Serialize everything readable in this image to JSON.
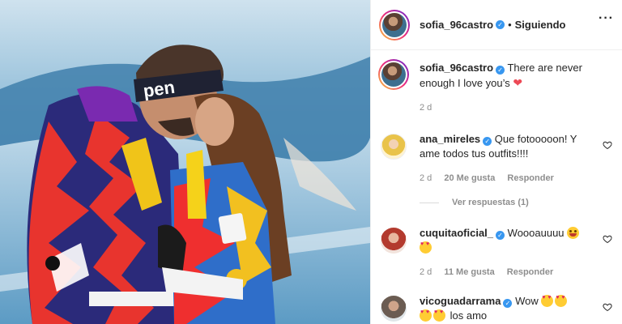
{
  "post": {
    "author": "sofia_96castro",
    "follow_status": "Siguiendo",
    "caption": "There are never enough I love you’s",
    "caption_time": "2 d",
    "photo_hat_text": "pen"
  },
  "comments": [
    {
      "user": "ana_mireles",
      "verified": true,
      "text": "Que fotooooon! Y ame todos tus outfits!!!!",
      "time": "2 d",
      "likes": "20 Me gusta",
      "reply": "Responder",
      "view_replies": "Ver respuestas (1)"
    },
    {
      "user": "cuquitaoficial_",
      "verified": true,
      "text": "Woooauuuu",
      "time": "2 d",
      "likes": "11 Me gusta",
      "reply": "Responder"
    },
    {
      "user": "vicoguadarrama",
      "verified": true,
      "text": "Wow",
      "text2": "los amo"
    }
  ],
  "icons": {
    "verified": "verified-badge-icon",
    "more": "more-options-icon",
    "like": "heart-outline-icon"
  },
  "colors": {
    "verified": "#3897f0",
    "meta": "#8e8e8e",
    "text": "#262626",
    "heart": "#ed4956"
  }
}
